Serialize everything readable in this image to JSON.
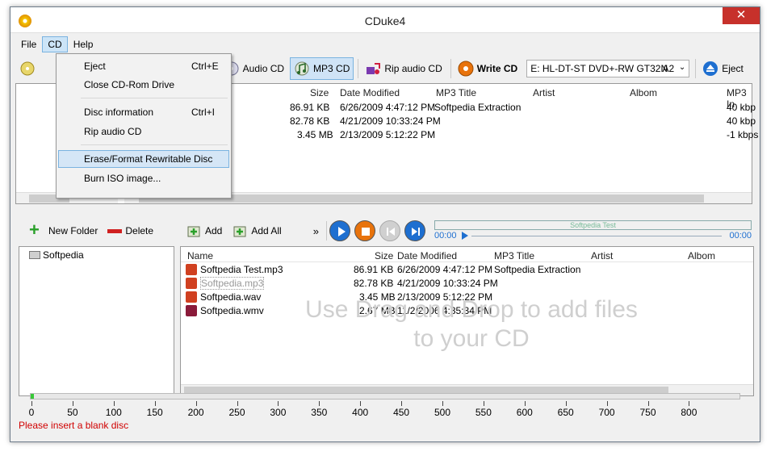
{
  "window": {
    "title": "CDuke4",
    "close_glyph": "✕"
  },
  "menubar": {
    "items": [
      "File",
      "CD",
      "Help"
    ]
  },
  "toolbar": {
    "audio_cd": "Audio CD",
    "mp3_cd": "MP3 CD",
    "rip_audio_cd": "Rip audio CD",
    "write_cd": "Write CD",
    "drive_select": "E: HL-DT-ST DVD+-RW GT32N",
    "drive_suffix": "A2",
    "eject": "Eject",
    "partial_d": "D"
  },
  "cd_menu": {
    "eject": {
      "label": "Eject",
      "shortcut": "Ctrl+E"
    },
    "close_drive": {
      "label": "Close CD-Rom Drive"
    },
    "disc_info": {
      "label": "Disc information",
      "shortcut": "Ctrl+I"
    },
    "rip": {
      "label": "Rip audio CD"
    },
    "erase": {
      "label": "Erase/Format Rewritable Disc"
    },
    "burn_iso": {
      "label": "Burn ISO image..."
    }
  },
  "upper_table": {
    "columns": {
      "size": "Size",
      "date": "Date Modified",
      "mp3title": "MP3 Title",
      "artist": "Artist",
      "album": "Albom",
      "mp3info": "MP3 In"
    },
    "rows": [
      {
        "size": "86.91 KB",
        "date": "6/26/2009 4:47:12 PM",
        "mp3title": "Softpedia Extraction",
        "bitrate": "40 kbp"
      },
      {
        "size": "82.78 KB",
        "date": "4/21/2009 10:33:24 PM",
        "mp3title": "",
        "bitrate": "40 kbp"
      },
      {
        "size": "3.45 MB",
        "date": "2/13/2009 5:12:22 PM",
        "mp3title": "",
        "bitrate": "-1 kbps"
      }
    ]
  },
  "lower_left_toolbar": {
    "new_folder": "New Folder",
    "delete": "Delete"
  },
  "lower_right_toolbar": {
    "add": "Add",
    "add_all": "Add All",
    "overflow": "»"
  },
  "player": {
    "track_title": "Softpedia Test",
    "time_start": "00:00",
    "time_end": "00:00"
  },
  "tree": {
    "root": "Softpedia"
  },
  "lower_table": {
    "columns": {
      "name": "Name",
      "size": "Size",
      "date": "Date Modified",
      "mp3title": "MP3 Title",
      "artist": "Artist",
      "album": "Albom"
    },
    "rows": [
      {
        "name": "Softpedia Test.mp3",
        "size": "86.91 KB",
        "date": "6/26/2009 4:47:12 PM",
        "mp3title": "Softpedia Extraction"
      },
      {
        "name": "Softpedia.mp3",
        "size": "82.78 KB",
        "date": "4/21/2009 10:33:24 PM",
        "mp3title": ""
      },
      {
        "name": "Softpedia.wav",
        "size": "3.45 MB",
        "date": "2/13/2009 5:12:22 PM",
        "mp3title": ""
      },
      {
        "name": "Softpedia.wmv",
        "size": "2.67 MB",
        "date": "11/2/2006 4:35:34 PM",
        "mp3title": ""
      }
    ],
    "drop_hint": "Use Drag and Drop to add files to your CD"
  },
  "capacity": {
    "ticks": [
      "0",
      "50",
      "100",
      "150",
      "200",
      "250",
      "300",
      "350",
      "400",
      "450",
      "500",
      "550",
      "600",
      "650",
      "700",
      "750",
      "800"
    ],
    "used_fraction": 0.002
  },
  "status": {
    "message": "Please insert a blank disc"
  },
  "colors": {
    "accent": "#cce4f7",
    "status_red": "#d00000",
    "close_red": "#c7312b",
    "write_orange": "#e8730c",
    "play_blue": "#1e6fd0"
  }
}
